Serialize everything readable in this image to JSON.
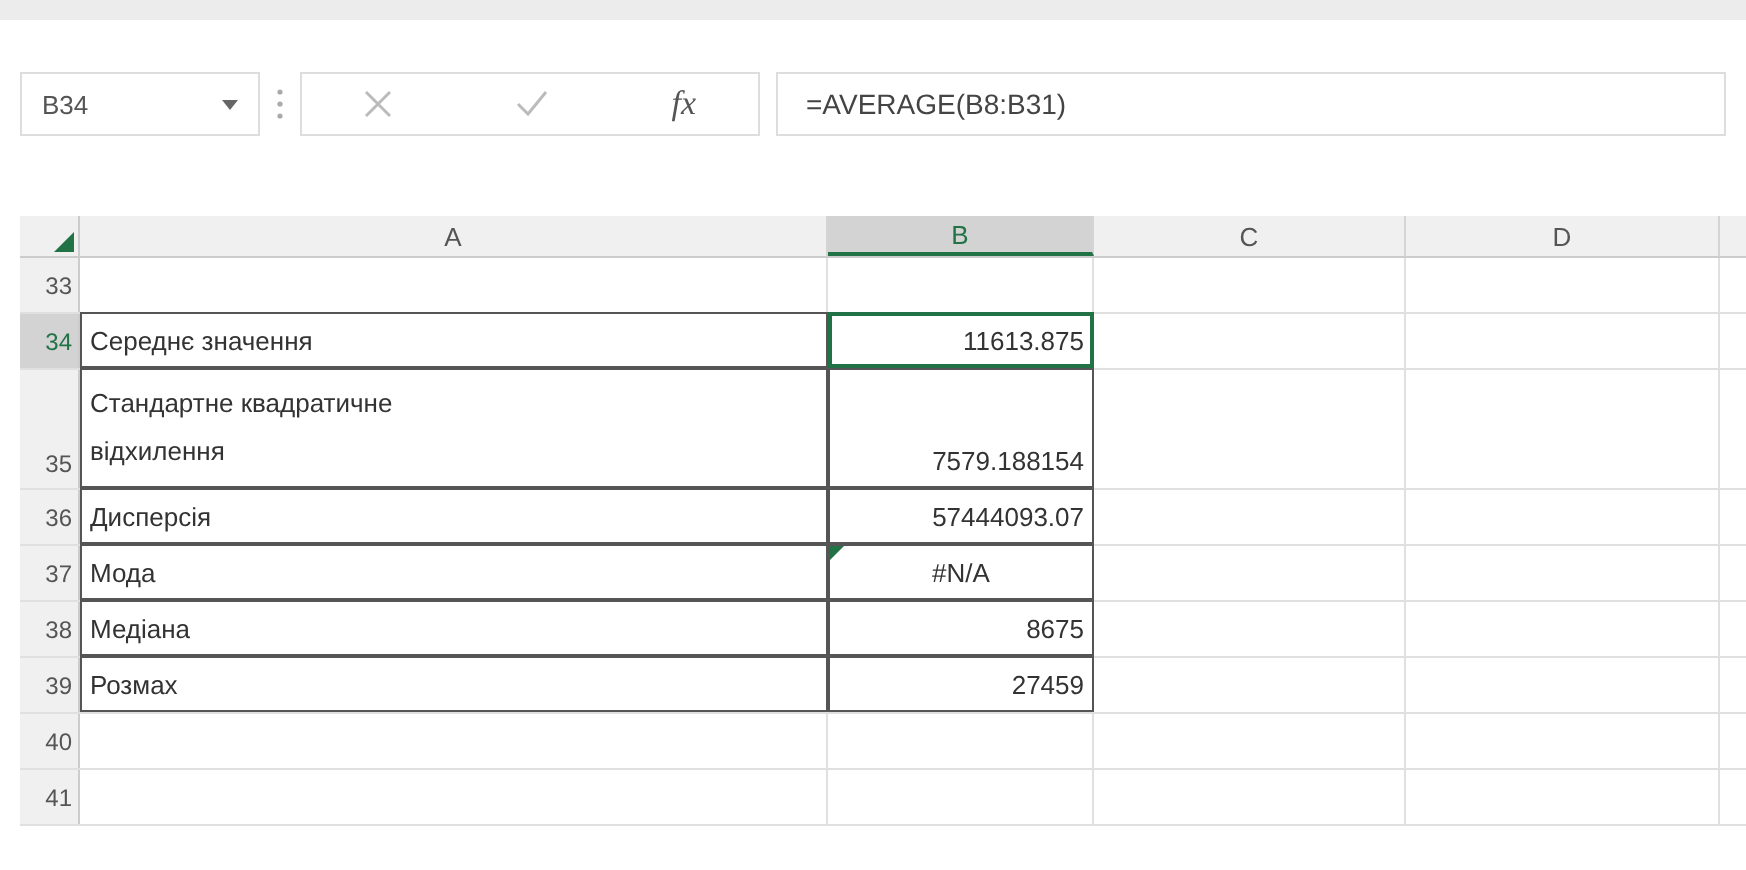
{
  "formula_bar": {
    "name_box": "B34",
    "function_label": "fx",
    "formula": "=AVERAGE(B8:B31)"
  },
  "columns": [
    {
      "label": "A",
      "selected": false
    },
    {
      "label": "B",
      "selected": true
    },
    {
      "label": "C",
      "selected": false
    },
    {
      "label": "D",
      "selected": false
    }
  ],
  "rows": [
    {
      "number": "33",
      "selected": false,
      "boxed": false,
      "cells": []
    },
    {
      "number": "34",
      "selected": true,
      "boxed": true,
      "cells": [
        {
          "text": "Середнє значення",
          "kind": "text"
        },
        {
          "text": "11613.875",
          "kind": "number"
        }
      ]
    },
    {
      "number": "35",
      "selected": false,
      "boxed": true,
      "tall": true,
      "cells": [
        {
          "text": "Стандартне квадратичне відхилення",
          "kind": "text"
        },
        {
          "text": "7579.188154",
          "kind": "number"
        }
      ]
    },
    {
      "number": "36",
      "selected": false,
      "boxed": true,
      "cells": [
        {
          "text": "Дисперсія",
          "kind": "text"
        },
        {
          "text": "57444093.07",
          "kind": "number"
        }
      ]
    },
    {
      "number": "37",
      "selected": false,
      "boxed": true,
      "cells": [
        {
          "text": "Мода",
          "kind": "text"
        },
        {
          "text": "#N/A",
          "kind": "error",
          "flagged": true
        }
      ]
    },
    {
      "number": "38",
      "selected": false,
      "boxed": true,
      "cells": [
        {
          "text": "Медіана",
          "kind": "text"
        },
        {
          "text": "8675",
          "kind": "number"
        }
      ]
    },
    {
      "number": "39",
      "selected": false,
      "boxed": true,
      "cells": [
        {
          "text": "Розмах",
          "kind": "text"
        },
        {
          "text": "27459",
          "kind": "number"
        }
      ]
    },
    {
      "number": "40",
      "selected": false,
      "boxed": false,
      "cells": []
    },
    {
      "number": "41",
      "selected": false,
      "boxed": false,
      "cells": []
    }
  ]
}
